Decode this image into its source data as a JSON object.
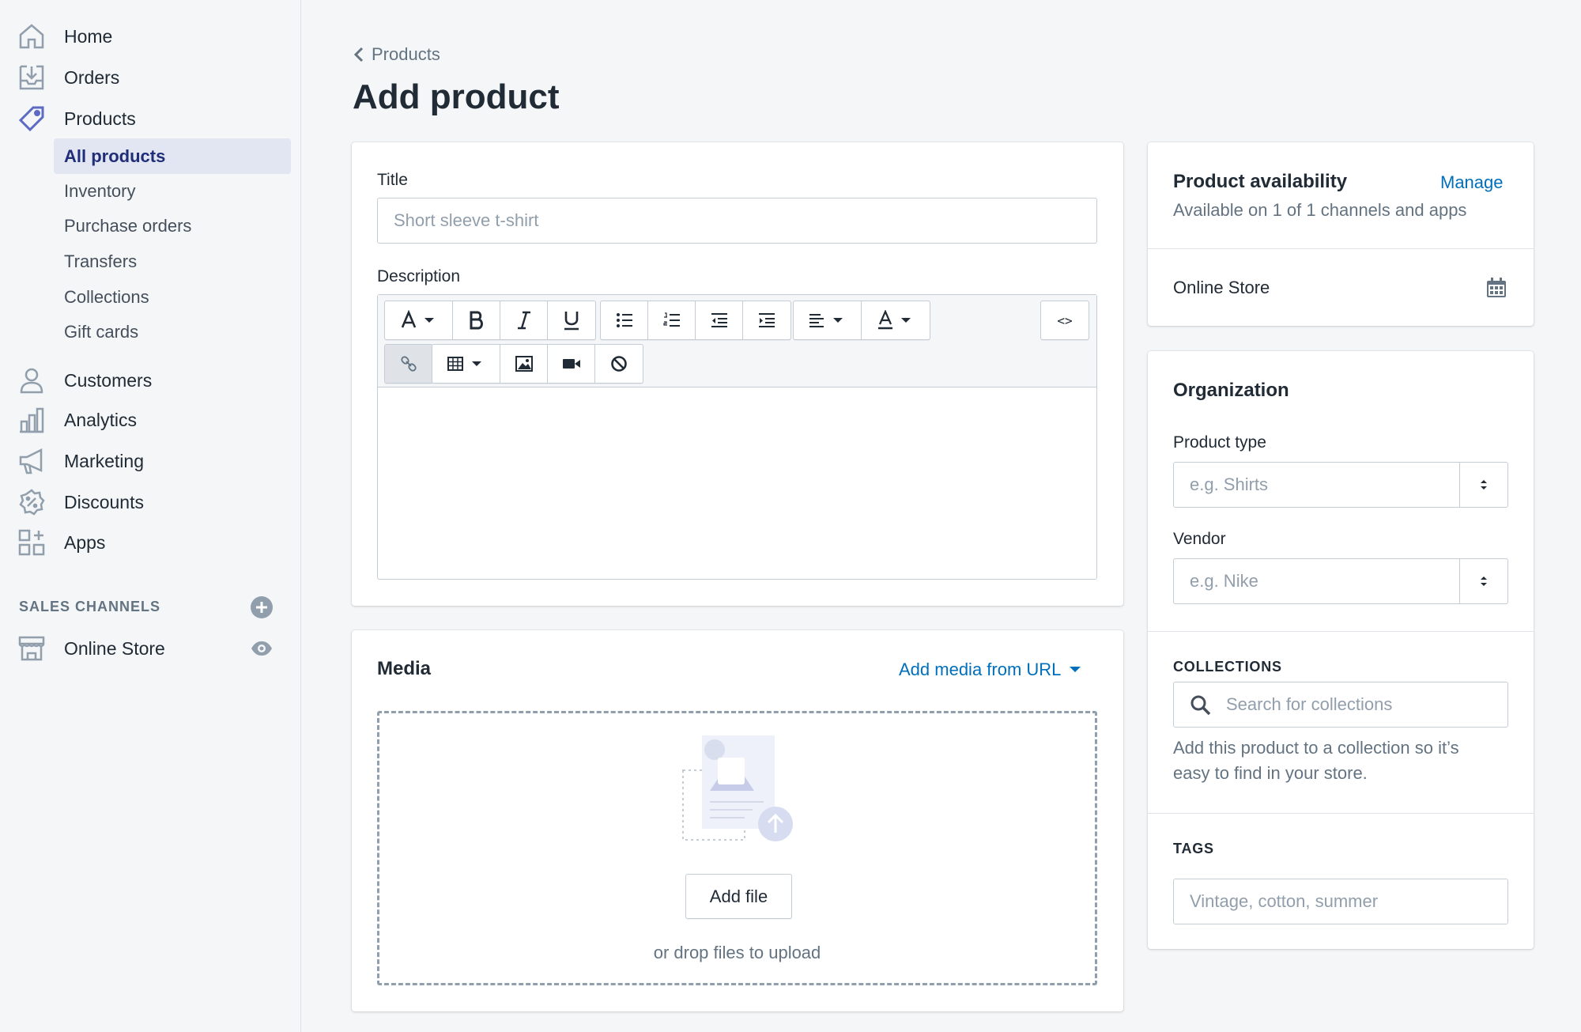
{
  "sidebar": {
    "nav": [
      {
        "label": "Home",
        "icon": "home-icon"
      },
      {
        "label": "Orders",
        "icon": "orders-icon"
      },
      {
        "label": "Products",
        "icon": "tag-icon"
      }
    ],
    "products_sub": [
      {
        "label": "All products",
        "active": true
      },
      {
        "label": "Inventory",
        "active": false
      },
      {
        "label": "Purchase orders",
        "active": false
      },
      {
        "label": "Transfers",
        "active": false
      },
      {
        "label": "Collections",
        "active": false
      },
      {
        "label": "Gift cards",
        "active": false
      }
    ],
    "nav2": [
      {
        "label": "Customers",
        "icon": "customers-icon"
      },
      {
        "label": "Analytics",
        "icon": "analytics-icon"
      },
      {
        "label": "Marketing",
        "icon": "marketing-icon"
      },
      {
        "label": "Discounts",
        "icon": "discounts-icon"
      },
      {
        "label": "Apps",
        "icon": "apps-icon"
      }
    ],
    "sales_channels_label": "SALES CHANNELS",
    "online_store_label": "Online Store"
  },
  "page": {
    "breadcrumb": "Products",
    "title": "Add product"
  },
  "details": {
    "title_label": "Title",
    "title_placeholder": "Short sleeve t-shirt",
    "description_label": "Description"
  },
  "media": {
    "title": "Media",
    "add_from_url": "Add media from URL",
    "add_file": "Add file",
    "drop_hint": "or drop files to upload"
  },
  "availability": {
    "title": "Product availability",
    "manage": "Manage",
    "subtitle": "Available on 1 of 1 channels and apps",
    "channel": "Online Store"
  },
  "organization": {
    "title": "Organization",
    "product_type_label": "Product type",
    "product_type_placeholder": "e.g. Shirts",
    "vendor_label": "Vendor",
    "vendor_placeholder": "e.g. Nike",
    "collections_label": "COLLECTIONS",
    "collections_placeholder": "Search for collections",
    "collections_help_1": "Add this product to a collection so it’s",
    "collections_help_2": "easy to find in your store.",
    "tags_label": "TAGS",
    "tags_placeholder": "Vintage, cotton, summer"
  },
  "colors": {
    "accent_link": "#006fbb",
    "active_nav_bg": "#e2e6f2",
    "active_nav_text": "#202e78",
    "product_icon": "#5c6ac4"
  }
}
